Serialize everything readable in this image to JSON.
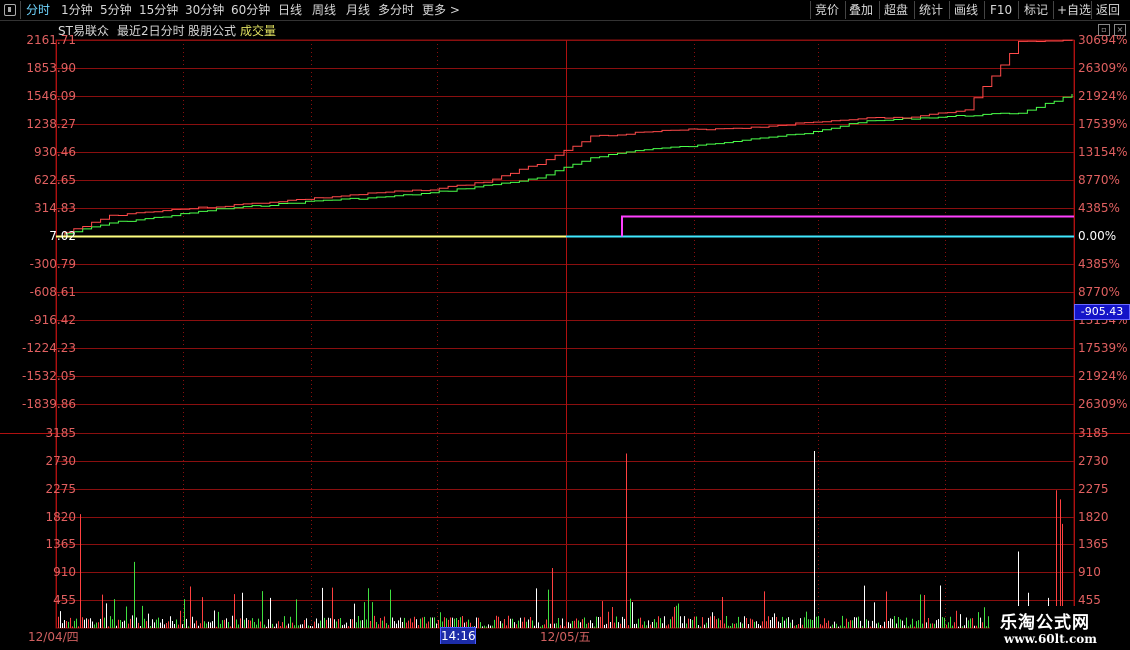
{
  "toolbar": {
    "periods": [
      {
        "label": "分时",
        "active": true
      },
      {
        "label": "1分钟",
        "active": false
      },
      {
        "label": "5分钟",
        "active": false
      },
      {
        "label": "15分钟",
        "active": false
      },
      {
        "label": "30分钟",
        "active": false
      },
      {
        "label": "60分钟",
        "active": false
      },
      {
        "label": "日线",
        "active": false
      },
      {
        "label": "周线",
        "active": false
      },
      {
        "label": "月线",
        "active": false
      },
      {
        "label": "多分时",
        "active": false
      },
      {
        "label": "更多 >",
        "active": false
      }
    ],
    "right_buttons": [
      "竞价",
      "叠加",
      "超盘",
      "统计",
      "画线",
      "F10",
      "标记",
      "+自选",
      "返回"
    ]
  },
  "info": {
    "stock_name": "ST易联众",
    "period_desc": "最近2日分时",
    "formula": "股朋公式",
    "indicator": "成交量"
  },
  "left_price_axis": [
    "2161.71",
    "1853.90",
    "1546.09",
    "1238.27",
    "930.46",
    "622.65",
    "314.83",
    "7.02",
    "-300.79",
    "-608.61",
    "-916.42",
    "-1224.23",
    "-1532.05",
    "-1839.86"
  ],
  "right_pct_axis": [
    "30694%",
    "26309%",
    "21924%",
    "17539%",
    "13154%",
    "8770%",
    "4385%",
    "0.00%",
    "4385%",
    "8770%",
    "13154%",
    "17539%",
    "21924%",
    "26309%"
  ],
  "current_price_tag": "-905.43",
  "volume_axis": [
    "3185",
    "2730",
    "2275",
    "1820",
    "1365",
    "910",
    "455"
  ],
  "dates": {
    "day1": "12/04/四",
    "day2": "12/05/五",
    "cursor_time": "14:16"
  },
  "watermark": {
    "title": "乐淘公式网",
    "url": "www.60lt.com"
  },
  "colors": {
    "price_line": "#ff4a4a",
    "avg_line": "#4aff4a",
    "base_line": "#ffff80",
    "indicator_pink": "#ff40ff",
    "indicator_cyan": "#40e8ff",
    "grid": "#8a0f0f",
    "up_vol": "#ff4040",
    "down_vol": "#40e040",
    "flat_vol": "#ffffff"
  },
  "chart_data": [
    {
      "type": "line",
      "title": "",
      "xlabel": "",
      "ylabel": "",
      "ylim": [
        -1839.86,
        2161.71
      ],
      "x": [
        "12/04/四",
        "12/05/五"
      ],
      "series": [
        {
          "values": [
            7.02,
            230,
            290,
            330,
            380,
            430,
            480,
            520,
            600,
            800,
            1100,
            1150,
            1180,
            1200,
            1250,
            1300,
            1310,
            1400,
            2140,
            2161.71
          ]
        },
        {
          "values": [
            7.02,
            150,
            220,
            300,
            350,
            400,
            430,
            480,
            560,
            640,
            870,
            960,
            1000,
            1080,
            1130,
            1260,
            1300,
            1330,
            1360,
            1560
          ]
        }
      ]
    },
    {
      "type": "bar",
      "title": "",
      "ylabel": "",
      "ylim": [
        0,
        3185
      ],
      "categories": [
        "12/04/四",
        "12/05/五"
      ],
      "series": [
        {
          "values": [
            1860,
            1080,
            650,
            400,
            850,
            2850,
            880,
            2890,
            2250,
            2100
          ]
        }
      ]
    }
  ]
}
